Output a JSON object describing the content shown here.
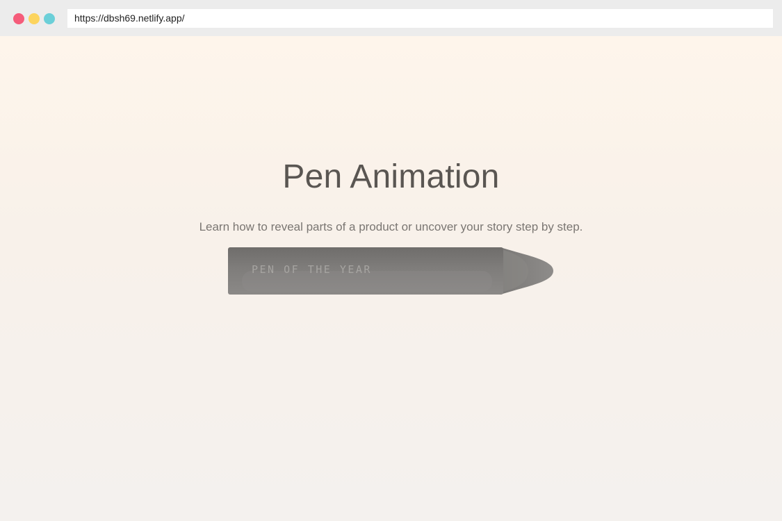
{
  "browser": {
    "url": "https://dbsh69.netlify.app/",
    "window_controls": [
      "close",
      "minimize",
      "maximize"
    ],
    "colors": {
      "close": "#f55c7a",
      "minimize": "#fcd45e",
      "maximize": "#6bcfd8"
    }
  },
  "hero": {
    "title": "Pen Animation",
    "subtitle": "Learn how to reveal parts of a product or uncover your story step by step."
  },
  "pen": {
    "label": "PEN OF THE YEAR",
    "body_color": "#7d7b79",
    "tip_color": "#8a8886"
  }
}
